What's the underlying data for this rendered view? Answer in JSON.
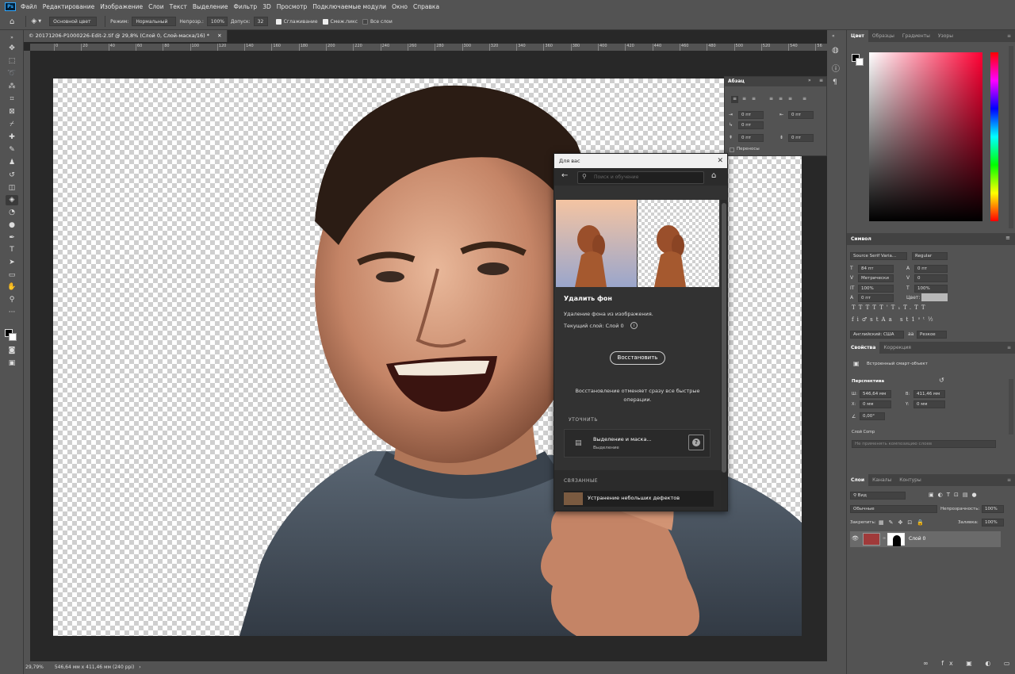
{
  "menubar": {
    "logo": "Ps",
    "items": [
      "Файл",
      "Редактирование",
      "Изображение",
      "Слои",
      "Текст",
      "Выделение",
      "Фильтр",
      "3D",
      "Просмотр",
      "Подключаемые модули",
      "Окно",
      "Справка"
    ]
  },
  "options": {
    "fill_source": "Основной цвет",
    "mode_label": "Режим:",
    "mode_value": "Нормальный",
    "opacity_label": "Непрозр.:",
    "opacity_value": "100%",
    "tolerance_label": "Допуск:",
    "tolerance_value": "32",
    "antialias_label": "Сглаживание",
    "contiguous_label": "Смеж.пикс",
    "all_layers_label": "Все слои"
  },
  "document": {
    "tab_title": "© 20171206-P1000226-Edit-2.tif @ 29,8% (Слой 0, Слой-маска/16) *",
    "ruler_ticks": [
      "0",
      "20",
      "40",
      "60",
      "80",
      "100",
      "120",
      "140",
      "160",
      "180",
      "200",
      "220",
      "240",
      "260",
      "280",
      "300",
      "320",
      "340",
      "360",
      "380",
      "400",
      "420",
      "440",
      "460",
      "480",
      "500",
      "520",
      "540",
      "56"
    ],
    "zoom": "29,79%",
    "doc_info": "546,64 мм x 411,46 мм (240 ppi)"
  },
  "paragraph_panel": {
    "title": "Абзац",
    "indent_left": "0 пт",
    "indent_right": "0 пт",
    "first_line": "0 пт",
    "space_before": "0 пт",
    "space_after": "0 пт",
    "hyphenation": "Переносы"
  },
  "for_you": {
    "title": "Для вас",
    "search_placeholder": "Поиск и обучение",
    "heading": "Удалить фон",
    "description": "Удаление фона из изображения.",
    "current_layer": "Текущий слой: Слой 0",
    "restore_button": "Восстановить",
    "restore_note": "Восстановление отменяет сразу все быстрые операции.",
    "refine_label": "УТОЧНИТЬ",
    "refine_item_title": "Выделение и маска...",
    "refine_item_sub": "Выделение",
    "related_label": "СВЯЗАННЫЕ",
    "related_item": "Устранение небольших дефектов"
  },
  "color_panel": {
    "tabs": [
      "Цвет",
      "Образцы",
      "Градиенты",
      "Узоры"
    ]
  },
  "character_panel": {
    "title": "Символ",
    "font_family": "Source Serif Varia...",
    "font_style": "Regular",
    "size": "84 пт",
    "leading": "0 пт",
    "kerning": "Метрически",
    "tracking": "0",
    "vscale": "100%",
    "hscale": "100%",
    "baseline": "0 пт",
    "color_label": "Цвет:",
    "language": "Английский: США",
    "antialias": "Резкое",
    "color_swatch": "#b8b8b8"
  },
  "properties_panel": {
    "tabs": [
      "Свойства",
      "Коррекция"
    ],
    "smart_object": "Встроенный смарт-объект",
    "transform_label": "Перспектива",
    "w_label": "Ш:",
    "w_value": "546,64 мм",
    "h_label": "В:",
    "h_value": "411,46 мм",
    "x_label": "X:",
    "x_value": "0 мм",
    "y_label": "Y:",
    "y_value": "0 мм",
    "angle": "0,00°",
    "comps_label": "Слой Comp",
    "comps_value": "Не применять композицию слоев"
  },
  "layers_panel": {
    "tabs": [
      "Слои",
      "Каналы",
      "Контуры"
    ],
    "filter": "Вид",
    "blend_mode": "Обычные",
    "opacity_label": "Непрозрачность:",
    "opacity_value": "100%",
    "lock_label": "Закрепить:",
    "fill_label": "Заливка:",
    "fill_value": "100%",
    "layer_name": "Слой 0"
  },
  "colors": {
    "ui_bg": "#535353",
    "panel_dark": "#424242",
    "canvas_bg": "#282828",
    "accent_blue": "#31a8ff"
  }
}
